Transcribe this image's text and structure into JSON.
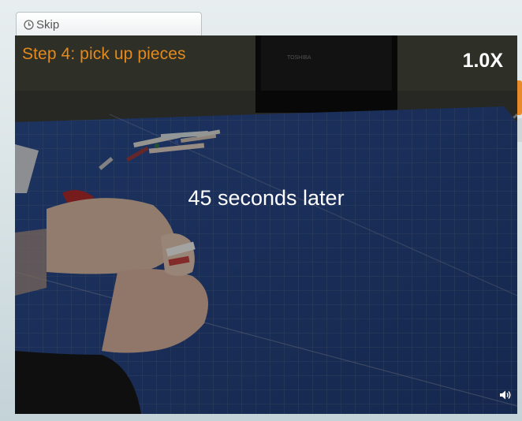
{
  "skip_tab": {
    "label": "Skip",
    "icon": "clock-icon"
  },
  "video": {
    "step_title": "Step 4: pick up pieces",
    "speed": "1.0X",
    "caption": "45 seconds later",
    "monitor_brand": "TOSHIBA",
    "volume_icon": "speaker-icon"
  },
  "colors": {
    "step_title": "#e48a1d",
    "accent_orange": "#e88a2a",
    "cutting_mat": "#1a3a7a"
  }
}
